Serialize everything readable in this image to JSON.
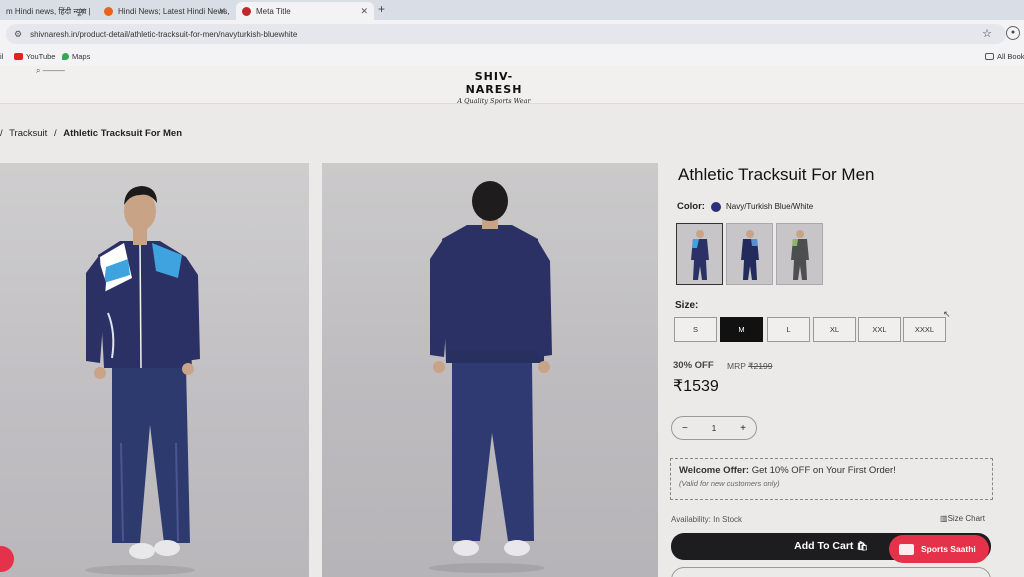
{
  "browser": {
    "tabs": [
      {
        "title": "m Hindi news, हिंदी न्यूज़ |",
        "color": "#c1272d"
      },
      {
        "title": "Hindi News; Latest Hindi News,",
        "color": "#e8641c"
      },
      {
        "title": "Meta Title",
        "color": "#c1272d"
      }
    ],
    "new_tab": "+",
    "url": "shivnaresh.in/product-detail/athletic-tracksuit-for-men/navyturkish-bluewhite",
    "bookmarks": [
      {
        "label": "il"
      },
      {
        "label": "YouTube"
      },
      {
        "label": "Maps"
      }
    ],
    "all_bookmarks": "All Book"
  },
  "site": {
    "brand": "SHIV-NARESH",
    "tagline": "A Quality Sports Wear"
  },
  "breadcrumb": {
    "sep1": "/",
    "cat": "Tracksuit",
    "sep2": "/",
    "current": "Athletic Tracksuit For Men"
  },
  "product": {
    "title": "Athletic Tracksuit For Men",
    "color_label": "Color:",
    "color_value": "Navy/Turkish Blue/White",
    "color_swatch": "#2b2f7a",
    "size_label": "Size:",
    "sizes": [
      "S",
      "M",
      "L",
      "XL",
      "XXL",
      "XXXL"
    ],
    "selected_size": "M",
    "discount": "30% OFF",
    "mrp_label": "MRP",
    "mrp_value": "₹2199",
    "price": "₹1539",
    "qty_minus": "−",
    "qty": "1",
    "qty_plus": "+",
    "offer_title": "Welcome Offer:",
    "offer_text": "Get 10% OFF on Your First Order!",
    "offer_note": "(Valid for new customers only)",
    "availability_label": "Availability:",
    "availability_value": "In Stock",
    "size_chart": "Size Chart",
    "add_to_cart": "Add To Cart"
  },
  "chat": {
    "label": "Sports Saathi"
  },
  "colors": {
    "navy": "#2b3165",
    "accent_blue": "#3fa3e0",
    "chat_red": "#e5324a"
  }
}
